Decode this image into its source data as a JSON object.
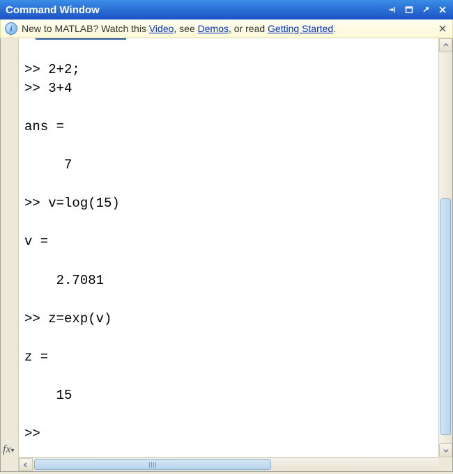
{
  "window": {
    "title": "Command Window"
  },
  "infobar": {
    "prefix": "New to MATLAB? Watch this ",
    "link_video": "Video",
    "mid1": ", see ",
    "link_demos": "Demos",
    "mid2": ", or read ",
    "link_started": "Getting Started",
    "suffix": "."
  },
  "console": {
    "lines": [
      "",
      ">> 2+2;",
      ">> 3+4",
      "",
      "ans =",
      "",
      "     7",
      "",
      ">> v=log(15)",
      "",
      "v =",
      "",
      "    2.7081",
      "",
      ">> z=exp(v)",
      "",
      "z =",
      "",
      "    15",
      "",
      ">> "
    ]
  },
  "fx_label": "fx"
}
